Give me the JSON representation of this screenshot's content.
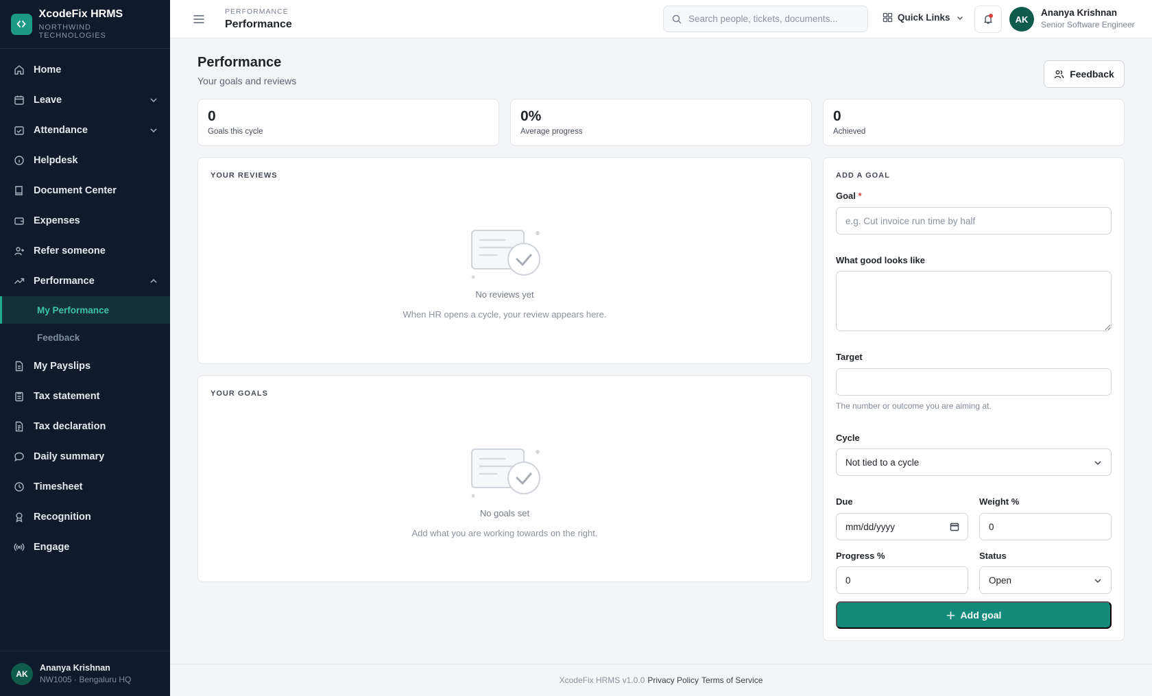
{
  "brand": {
    "name": "XcodeFix HRMS",
    "org": "NORTHWIND TECHNOLOGIES",
    "accent": "#1d9a86"
  },
  "sidebar": {
    "items": [
      {
        "label": "Home",
        "icon": "home-icon"
      },
      {
        "label": "Leave",
        "icon": "calendar-icon",
        "expandable": true
      },
      {
        "label": "Attendance",
        "icon": "calendar-check-icon",
        "expandable": true
      },
      {
        "label": "Helpdesk",
        "icon": "info-icon"
      },
      {
        "label": "Document Center",
        "icon": "book-icon"
      },
      {
        "label": "Expenses",
        "icon": "wallet-icon"
      },
      {
        "label": "Refer someone",
        "icon": "user-plus-icon"
      },
      {
        "label": "Performance",
        "icon": "trending-up-icon",
        "expanded": true
      },
      {
        "label": "My Payslips",
        "icon": "file-icon"
      },
      {
        "label": "Tax statement",
        "icon": "clipboard-icon"
      },
      {
        "label": "Tax declaration",
        "icon": "file-text-icon"
      },
      {
        "label": "Daily summary",
        "icon": "message-icon"
      },
      {
        "label": "Timesheet",
        "icon": "clock-icon"
      },
      {
        "label": "Recognition",
        "icon": "award-icon"
      },
      {
        "label": "Engage",
        "icon": "broadcast-icon"
      }
    ],
    "performance_sub": [
      {
        "label": "My Performance",
        "active": true
      },
      {
        "label": "Feedback",
        "active": false
      }
    ],
    "footer": {
      "initials": "AK",
      "name": "Ananya Krishnan",
      "meta": "NW1005 · Bengaluru HQ"
    }
  },
  "header": {
    "breadcrumb": "PERFORMANCE",
    "title": "Performance",
    "search_placeholder": "Search people, tickets, documents...",
    "quick_links": "Quick Links",
    "user": {
      "initials": "AK",
      "name": "Ananya Krishnan",
      "role": "Senior Software Engineer"
    }
  },
  "page": {
    "title": "Performance",
    "subtitle": "Your goals and reviews",
    "feedback_button": "Feedback",
    "stats": [
      {
        "value": "0",
        "label": "Goals this cycle"
      },
      {
        "value": "0%",
        "label": "Average progress"
      },
      {
        "value": "0",
        "label": "Achieved"
      }
    ],
    "reviews": {
      "heading": "YOUR REVIEWS",
      "empty_title": "No reviews yet",
      "empty_sub": "When HR opens a cycle, your review appears here."
    },
    "goals": {
      "heading": "YOUR GOALS",
      "empty_title": "No goals set",
      "empty_sub": "Add what you are working towards on the right."
    }
  },
  "form": {
    "heading": "ADD A GOAL",
    "goal_label": "Goal",
    "goal_required_mark": "*",
    "goal_placeholder": "e.g. Cut invoice run time by half",
    "good_label": "What good looks like",
    "good_value": "",
    "target_label": "Target",
    "target_value": "",
    "target_hint": "The number or outcome you are aiming at.",
    "cycle_label": "Cycle",
    "cycle_value": "Not tied to a cycle",
    "due_label": "Due",
    "due_placeholder": "mm/dd/yyyy",
    "weight_label": "Weight %",
    "weight_value": "0",
    "progress_label": "Progress %",
    "progress_value": "0",
    "status_label": "Status",
    "status_value": "Open",
    "submit": "Add goal"
  },
  "footer": {
    "version": "XcodeFix HRMS v1.0.0",
    "privacy": "Privacy Policy",
    "terms": "Terms of Service"
  }
}
